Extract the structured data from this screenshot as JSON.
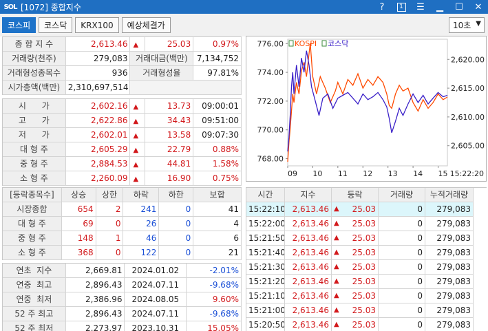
{
  "window": {
    "logo": "SOL",
    "title": "[1072] 종합지수",
    "help": "?",
    "box_num": "1"
  },
  "toolbar": {
    "tabs": [
      "코스피",
      "코스닥",
      "KRX100",
      "예상체결가"
    ],
    "interval": "10초"
  },
  "summary": {
    "index_label": "종 합 지 수",
    "index_value": "2,613.46",
    "index_change": "25.03",
    "index_rate": "0.97%",
    "volume_label": "거래량(천주)",
    "volume_value": "279,083",
    "amount_label": "거래대금(백만)",
    "amount_value": "7,134,752",
    "formed_label": "거래형성종목수",
    "formed_value": "936",
    "formed_rate_label": "거래형성율",
    "formed_rate_value": "97.81%",
    "mktcap_label": "시가총액(백만)",
    "mktcap_value": "2,310,697,514"
  },
  "prices": [
    {
      "label": "시      가",
      "value": "2,602.16",
      "change": "13.73",
      "extra": "09:00:01",
      "extra_red": false
    },
    {
      "label": "고      가",
      "value": "2,622.86",
      "change": "34.43",
      "extra": "09:51:00",
      "extra_red": false
    },
    {
      "label": "저      가",
      "value": "2,602.01",
      "change": "13.58",
      "extra": "09:07:30",
      "extra_red": false
    },
    {
      "label": "대 형 주",
      "value": "2,605.29",
      "change": "22.79",
      "extra": "0.88%",
      "extra_red": true
    },
    {
      "label": "중 형 주",
      "value": "2,884.53",
      "change": "44.81",
      "extra": "1.58%",
      "extra_red": true
    },
    {
      "label": "소 형 주",
      "value": "2,260.09",
      "change": "16.90",
      "extra": "0.75%",
      "extra_red": true
    }
  ],
  "breadth": {
    "headers": [
      "[등락종목수]",
      "상승",
      "상한",
      "하락",
      "하한",
      "보합"
    ],
    "rows": [
      {
        "label": "시장종합",
        "up": "654",
        "upper": "2",
        "down": "241",
        "lower": "0",
        "flat": "41"
      },
      {
        "label": "대 형 주",
        "up": "69",
        "upper": "0",
        "down": "26",
        "lower": "0",
        "flat": "4"
      },
      {
        "label": "중 형 주",
        "up": "148",
        "upper": "1",
        "down": "46",
        "lower": "0",
        "flat": "6"
      },
      {
        "label": "소 형 주",
        "up": "368",
        "upper": "0",
        "down": "122",
        "lower": "0",
        "flat": "21"
      }
    ]
  },
  "records": [
    {
      "label": "연초  지수",
      "value": "2,669.81",
      "date": "2024.01.02",
      "rate": "-2.01%",
      "neg": true
    },
    {
      "label": "연중  최고",
      "value": "2,896.43",
      "date": "2024.07.11",
      "rate": "-9.68%",
      "neg": true
    },
    {
      "label": "연중  최저",
      "value": "2,386.96",
      "date": "2024.08.05",
      "rate": "9.60%",
      "neg": false
    },
    {
      "label": "52 주 최고",
      "value": "2,896.43",
      "date": "2024.07.11",
      "rate": "-9.68%",
      "neg": true
    },
    {
      "label": "52 주 최저",
      "value": "2,273.97",
      "date": "2023.10.31",
      "rate": "15.05%",
      "neg": false
    }
  ],
  "ticks": {
    "headers": [
      "시간",
      "지수",
      "등락",
      "거래량",
      "누적거래량"
    ],
    "rows": [
      {
        "time": "15:22:10",
        "index": "2,613.46",
        "change": "25.03",
        "vol": "0",
        "cum": "279,083"
      },
      {
        "time": "15:22:00",
        "index": "2,613.46",
        "change": "25.03",
        "vol": "0",
        "cum": "279,083"
      },
      {
        "time": "15:21:50",
        "index": "2,613.46",
        "change": "25.03",
        "vol": "0",
        "cum": "279,083"
      },
      {
        "time": "15:21:40",
        "index": "2,613.46",
        "change": "25.03",
        "vol": "0",
        "cum": "279,083"
      },
      {
        "time": "15:21:30",
        "index": "2,613.46",
        "change": "25.03",
        "vol": "0",
        "cum": "279,083"
      },
      {
        "time": "15:21:20",
        "index": "2,613.46",
        "change": "25.03",
        "vol": "0",
        "cum": "279,083"
      },
      {
        "time": "15:21:10",
        "index": "2,613.46",
        "change": "25.03",
        "vol": "0",
        "cum": "279,083"
      },
      {
        "time": "15:21:00",
        "index": "2,613.46",
        "change": "25.03",
        "vol": "0",
        "cum": "279,083"
      },
      {
        "time": "15:20:50",
        "index": "2,613.46",
        "change": "25.03",
        "vol": "0",
        "cum": "279,083"
      }
    ]
  },
  "colors": {
    "accent": "#1e73c9",
    "up": "#d2191c",
    "down": "#1a4fd6",
    "kospi_line": "#ff4a00",
    "kosdaq_line": "#3a20c8",
    "highlight_row": "#dcf6fb"
  },
  "chart_data": {
    "type": "line",
    "legend": [
      "KOSPI",
      "코스닥"
    ],
    "x_ticks": [
      "09",
      "10",
      "11",
      "12",
      "13",
      "14",
      "15"
    ],
    "x_last_label": "15:22:20",
    "x_range": [
      9.0,
      15.37
    ],
    "left_axis": {
      "ticks": [
        "776.00",
        "774.00",
        "772.00",
        "770.00",
        "768.00"
      ],
      "range": [
        767.5,
        776.3
      ]
    },
    "right_axis": {
      "ticks": [
        "2,620.00",
        "2,615.00",
        "2,610.00",
        "2,605.00"
      ],
      "range": [
        2601.5,
        2623.5
      ]
    },
    "series": [
      {
        "name": "KOSPI",
        "axis": "right",
        "x": [
          9.0,
          9.05,
          9.1,
          9.15,
          9.2,
          9.25,
          9.35,
          9.45,
          9.55,
          9.65,
          9.75,
          9.85,
          9.9,
          10.0,
          10.15,
          10.3,
          10.5,
          10.7,
          10.9,
          11.0,
          11.2,
          11.4,
          11.6,
          11.8,
          12.0,
          12.2,
          12.4,
          12.6,
          12.8,
          12.95,
          13.05,
          13.15,
          13.3,
          13.45,
          13.6,
          13.8,
          14.0,
          14.2,
          14.4,
          14.6,
          14.8,
          15.0,
          15.2,
          15.37
        ],
        "y": [
          2602.2,
          2605.5,
          2608.0,
          2611.0,
          2614.0,
          2612.5,
          2616.0,
          2614.0,
          2618.0,
          2619.5,
          2617.0,
          2621.0,
          2622.8,
          2617.0,
          2614.0,
          2617.0,
          2615.0,
          2612.5,
          2614.5,
          2616.0,
          2614.0,
          2616.5,
          2615.5,
          2617.5,
          2615.0,
          2616.5,
          2615.5,
          2617.0,
          2616.0,
          2614.0,
          2612.0,
          2611.5,
          2614.0,
          2615.5,
          2614.5,
          2615.0,
          2612.5,
          2611.0,
          2613.0,
          2611.5,
          2612.5,
          2614.0,
          2613.0,
          2613.46
        ]
      },
      {
        "name": "코스닥",
        "axis": "left",
        "x": [
          9.0,
          9.05,
          9.1,
          9.15,
          9.2,
          9.25,
          9.35,
          9.45,
          9.55,
          9.65,
          9.75,
          9.85,
          9.95,
          10.1,
          10.25,
          10.4,
          10.6,
          10.8,
          11.0,
          11.2,
          11.4,
          11.6,
          11.8,
          12.0,
          12.2,
          12.4,
          12.6,
          12.8,
          12.95,
          13.05,
          13.15,
          13.3,
          13.45,
          13.6,
          13.8,
          14.0,
          14.2,
          14.4,
          14.6,
          14.8,
          15.0,
          15.2,
          15.37
        ],
        "y": [
          768.5,
          769.5,
          771.0,
          773.0,
          774.0,
          772.5,
          774.5,
          773.0,
          775.0,
          774.0,
          775.5,
          774.5,
          773.0,
          772.0,
          771.0,
          772.2,
          772.5,
          771.5,
          772.2,
          772.4,
          772.6,
          772.2,
          771.8,
          772.5,
          772.1,
          772.3,
          772.6,
          772.1,
          771.6,
          770.8,
          769.8,
          770.6,
          771.5,
          771.0,
          771.8,
          772.5,
          771.9,
          772.4,
          771.8,
          772.2,
          772.6,
          772.3,
          772.4
        ]
      }
    ]
  }
}
